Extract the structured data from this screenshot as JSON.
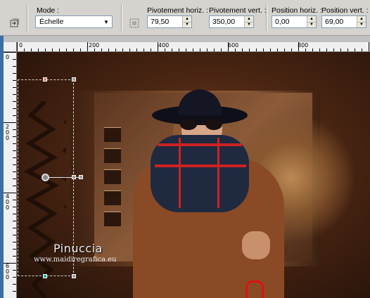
{
  "toolbar": {
    "mode_label": "Mode :",
    "mode_value": "Échelle",
    "pivot_h_label": "Pivotement horiz. :",
    "pivot_h_value": "79,50",
    "pivot_v_label": "Pivotement vert. :",
    "pivot_v_value": "350,00",
    "pos_h_label": "Position horiz. :",
    "pos_h_value": "0,00",
    "pos_v_label": "Position vert. :",
    "pos_v_value": "69,00"
  },
  "ruler": {
    "h_labels": [
      "0",
      "200",
      "400",
      "600",
      "800"
    ],
    "v_labels": [
      [
        "0"
      ],
      [
        "2",
        "0",
        "0"
      ],
      [
        "4",
        "0",
        "0"
      ],
      [
        "6",
        "0",
        "0"
      ]
    ]
  },
  "watermark": {
    "name": "Pinuccia",
    "url": "www.maidiregrafica.eu"
  },
  "colors": {
    "accent": "#3a6ea5",
    "scarf_red": "#cc2222",
    "coat": "#8b4a26"
  }
}
